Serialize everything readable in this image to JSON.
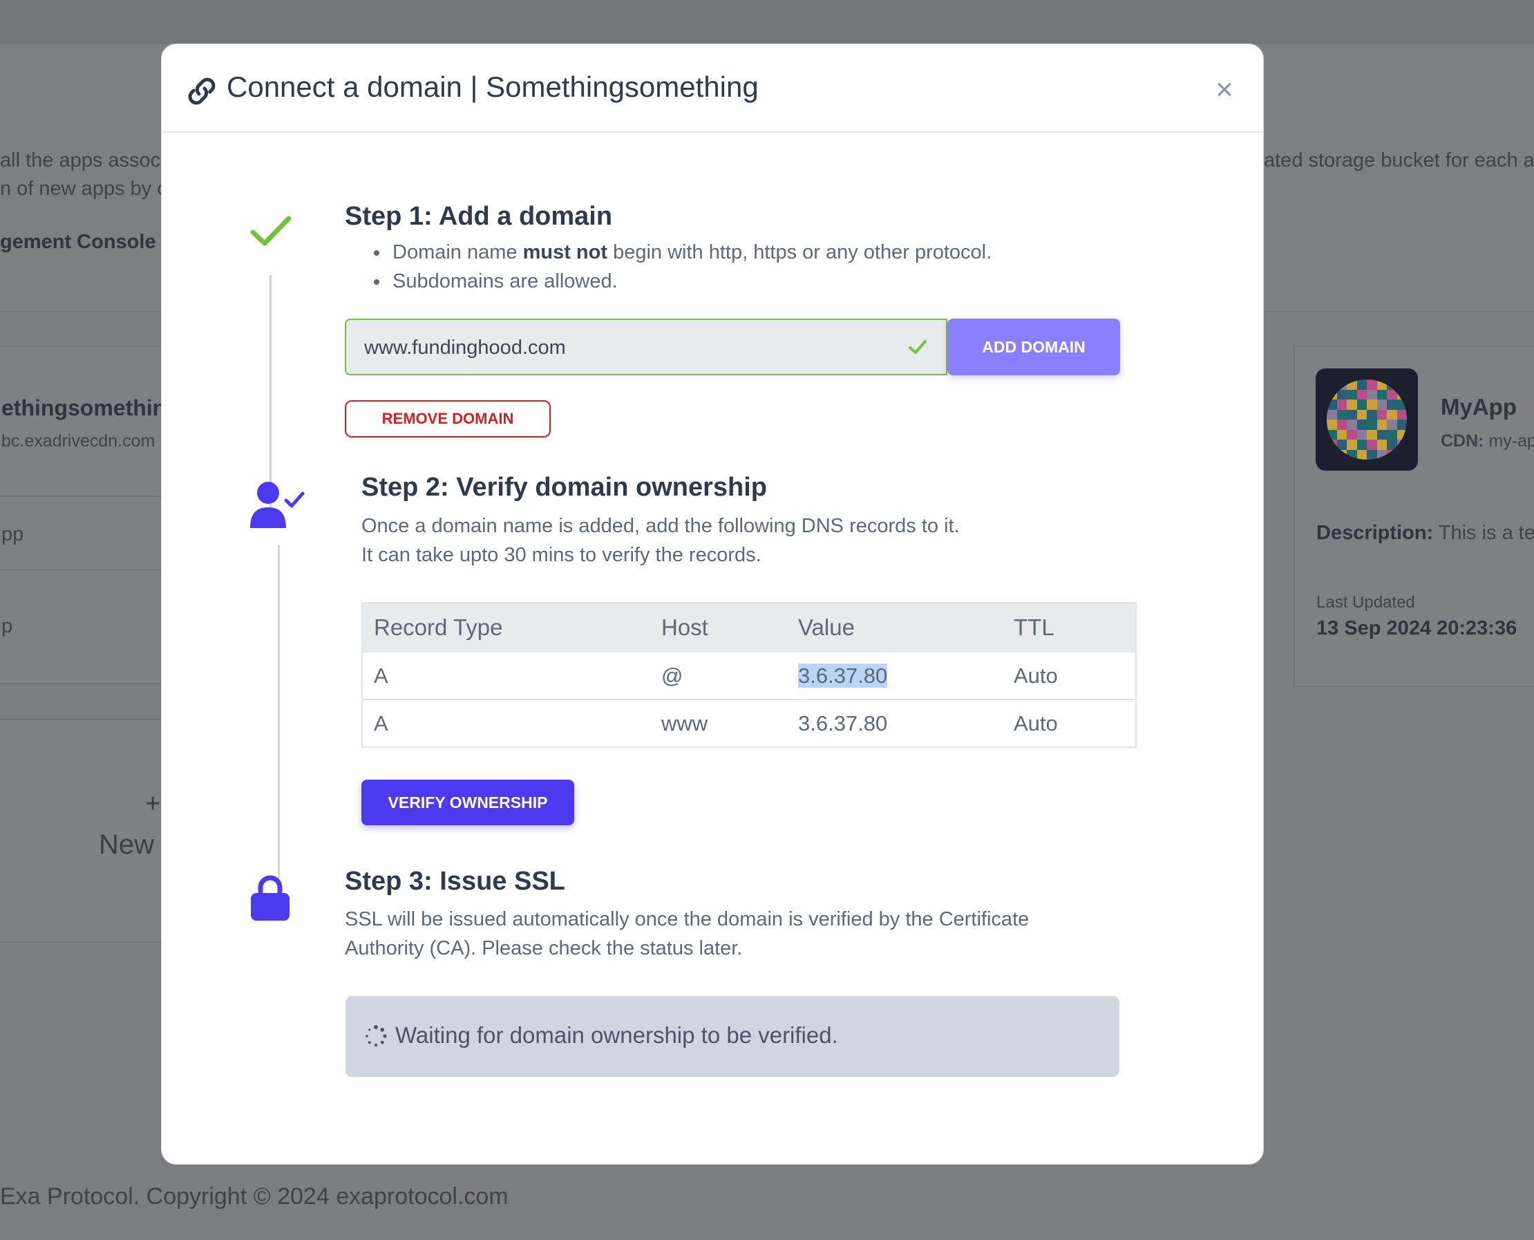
{
  "background": {
    "intro_line1_left": "all the apps assoc",
    "intro_line2_left": "n of new apps by cl",
    "intro_line3_left": "gement Console is",
    "intro_line1_right": "ated storage bucket for each a",
    "app_left_name": "ethingsomethin",
    "app_left_cdn": "bc.exadrivecdn.com",
    "app_left_row1": "pp",
    "app_left_row2": "p",
    "new_app_plus": "+",
    "new_app_label": "New",
    "app_right_name": "MyApp",
    "app_right_cdn_label": "CDN:",
    "app_right_cdn_value": "my-ap",
    "app_right_desc_label": "Description:",
    "app_right_desc_value": "This is a te",
    "last_updated_label": "Last Updated",
    "last_updated_value": "13 Sep 2024 20:23:36",
    "footer": "Exa Protocol. Copyright © 2024 exaprotocol.com"
  },
  "modal": {
    "title": "Connect a domain | Somethingsomething",
    "close_label": "×",
    "header_icon": "link-icon",
    "colors": {
      "accent": "#4b3af0",
      "accent_light": "#8a80ff",
      "success": "#74c238",
      "danger": "#d81f1f",
      "heading": "#2d3a4f"
    },
    "step1": {
      "icon": "check-icon",
      "title": "Step 1: Add a domain",
      "bullet1_pre": "Domain name ",
      "bullet1_bold": "must not",
      "bullet1_post": " begin with http, https or any other protocol.",
      "bullet2": "Subdomains are allowed.",
      "domain_value": "www.fundinghood.com",
      "add_button": "ADD DOMAIN",
      "remove_button": "REMOVE DOMAIN"
    },
    "step2": {
      "icon": "user-check-icon",
      "title": "Step 2: Verify domain ownership",
      "line1": "Once a domain name is added, add the following DNS records to it.",
      "line2": "It can take upto 30 mins to verify the records.",
      "table": {
        "headers": [
          "Record Type",
          "Host",
          "Value",
          "TTL"
        ],
        "rows": [
          [
            "A",
            "@",
            "3.6.37.80",
            "Auto"
          ],
          [
            "A",
            "www",
            "3.6.37.80",
            "Auto"
          ]
        ]
      },
      "verify_button": "VERIFY OWNERSHIP"
    },
    "step3": {
      "icon": "lock-icon",
      "title": "Step 3: Issue SSL",
      "line1": "SSL will be issued automatically once the domain is verified by the Certificate",
      "line2": "Authority (CA). Please check the status later.",
      "status_icon": "spinner-icon",
      "status": "Waiting for domain ownership to be verified."
    }
  }
}
